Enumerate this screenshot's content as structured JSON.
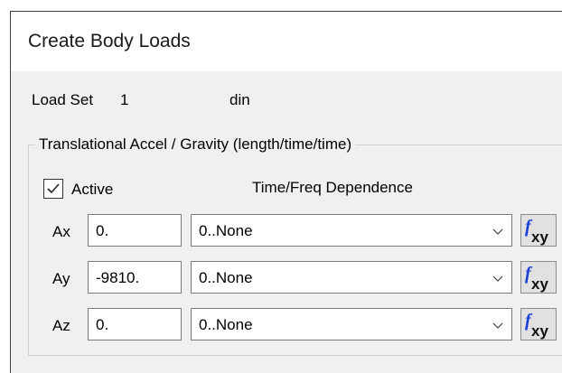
{
  "dialog": {
    "title": "Create Body Loads"
  },
  "load_set": {
    "label": "Load Set",
    "number": "1",
    "name": "din"
  },
  "group": {
    "label": "Translational Accel / Gravity  (length/time/time)"
  },
  "active": {
    "label": "Active",
    "checked": true
  },
  "dependence_header": "Time/Freq Dependence",
  "rows": [
    {
      "label": "Ax",
      "value": "0.",
      "dependence": "0..None"
    },
    {
      "label": "Ay",
      "value": "-9810.",
      "dependence": "0..None"
    },
    {
      "label": "Az",
      "value": "0.",
      "dependence": "0..None"
    }
  ],
  "icons": {
    "function_button": "fxy-function-icon",
    "dropdown": "chevron-down-icon",
    "check": "checkmark-icon"
  },
  "colors": {
    "fx_blue": "#1a3fd6",
    "window_bg": "#f0f0f0"
  }
}
